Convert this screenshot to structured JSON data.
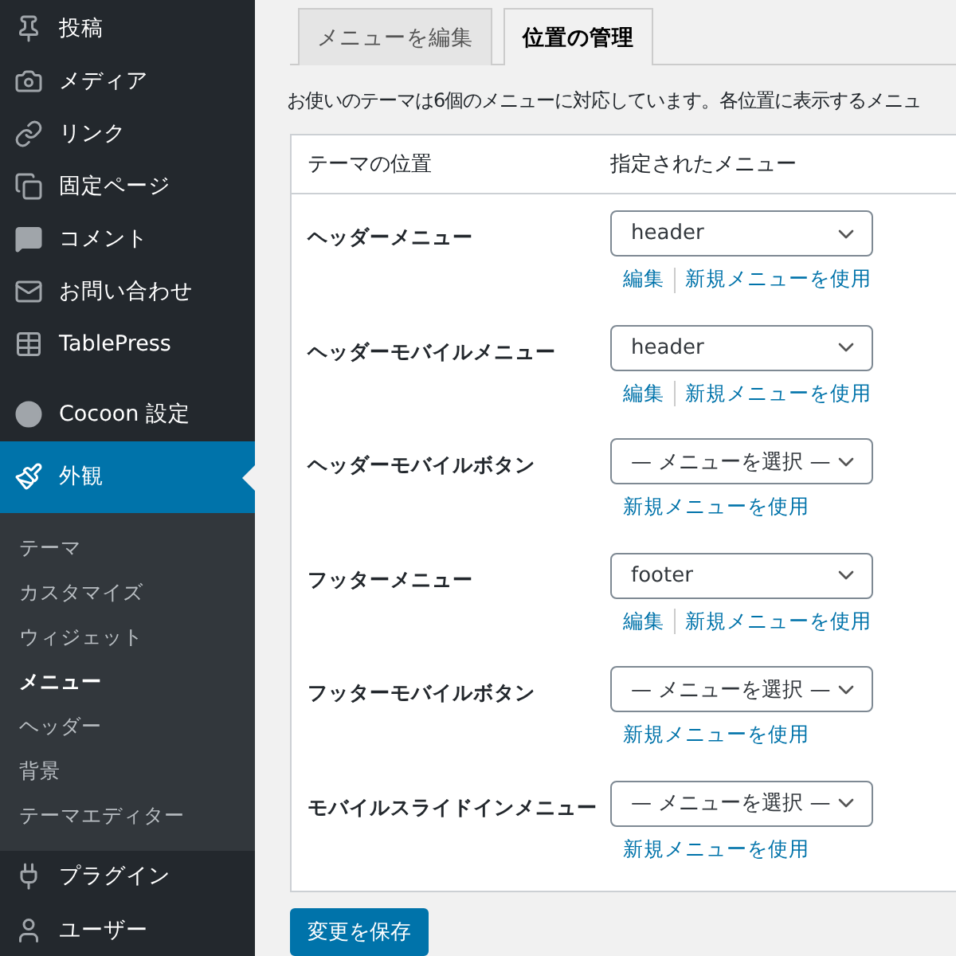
{
  "sidebar": {
    "items": [
      {
        "label": "投稿",
        "selected": false
      },
      {
        "label": "メディア",
        "selected": false
      },
      {
        "label": "リンク",
        "selected": false
      },
      {
        "label": "固定ページ",
        "selected": false
      },
      {
        "label": "コメント",
        "selected": false
      },
      {
        "label": "お問い合わせ",
        "selected": false
      },
      {
        "label": "TablePress",
        "selected": false
      },
      {
        "label": "Cocoon 設定",
        "selected": false
      },
      {
        "label": "外観",
        "selected": true,
        "children": [
          {
            "label": "テーマ",
            "selected": false
          },
          {
            "label": "カスタマイズ",
            "selected": false
          },
          {
            "label": "ウィジェット",
            "selected": false
          },
          {
            "label": "メニュー",
            "selected": true
          },
          {
            "label": "ヘッダー",
            "selected": false
          },
          {
            "label": "背景",
            "selected": false
          },
          {
            "label": "テーマエディター",
            "selected": false
          }
        ]
      },
      {
        "label": "プラグイン",
        "selected": false
      },
      {
        "label": "ユーザー",
        "selected": false
      }
    ]
  },
  "tabs": [
    {
      "label": "メニューを編集",
      "selected": false
    },
    {
      "label": "位置の管理",
      "selected": true
    }
  ],
  "intro": "お使いのテーマは6個のメニューに対応しています。各位置に表示するメニュ",
  "table": {
    "columns": [
      "テーマの位置",
      "指定されたメニュー"
    ],
    "rows": [
      {
        "location": "ヘッダーメニュー",
        "menu": "header",
        "links": [
          "編集",
          "新規メニューを使用"
        ]
      },
      {
        "location": "ヘッダーモバイルメニュー",
        "menu": "header",
        "links": [
          "編集",
          "新規メニューを使用"
        ]
      },
      {
        "location": "ヘッダーモバイルボタン",
        "menu": "— メニューを選択 —",
        "links": [
          "新規メニューを使用"
        ]
      },
      {
        "location": "フッターメニュー",
        "menu": "footer",
        "links": [
          "編集",
          "新規メニューを使用"
        ]
      },
      {
        "location": "フッターモバイルボタン",
        "menu": "— メニューを選択 —",
        "links": [
          "新規メニューを使用"
        ]
      },
      {
        "location": "モバイルスライドインメニュー",
        "menu": "— メニューを選択 —",
        "links": [
          "新規メニューを使用"
        ]
      }
    ]
  },
  "save_button": "変更を保存"
}
